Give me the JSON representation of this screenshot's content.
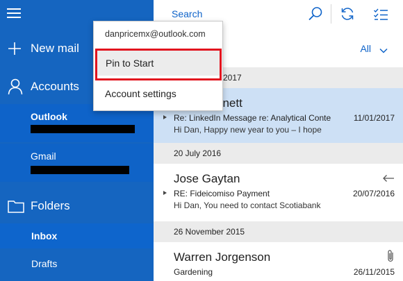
{
  "sidebar": {
    "new_mail": "New mail",
    "accounts": "Accounts",
    "account_list": [
      {
        "name": "Outlook"
      },
      {
        "name": "Gmail"
      }
    ],
    "folders": "Folders",
    "folder_list": [
      {
        "name": "Inbox",
        "selected": true
      },
      {
        "name": "Drafts",
        "selected": false
      }
    ]
  },
  "toolbar": {
    "search_placeholder": "Search",
    "filter_label": "All"
  },
  "popup": {
    "email": "danpricemx@outlook.com",
    "pin_to_start": "Pin to Start",
    "account_settings": "Account settings"
  },
  "groups": [
    {
      "date_header": "2017",
      "messages": [
        {
          "sender": "nnett",
          "subject": "Re: LinkedIn Message re: Analytical Conte",
          "date": "11/01/2017",
          "preview": "Hi Dan,     Happy new year to you – I hope",
          "selected": true
        }
      ]
    },
    {
      "date_header": "20 July 2016",
      "messages": [
        {
          "sender": "Jose Gaytan",
          "subject": "RE: Fideicomiso Payment",
          "date": "20/07/2016",
          "preview": "Hi Dan,     You need to contact Scotiabank",
          "icon": "reply-arrow-icon"
        }
      ]
    },
    {
      "date_header": "26 November 2015",
      "messages": [
        {
          "sender": "Warren Jorgenson",
          "subject": "Gardening",
          "date": "26/11/2015",
          "preview": "",
          "icon": "paperclip-icon"
        }
      ]
    }
  ],
  "colors": {
    "sidebar": "#1565c0",
    "accent": "#0e63c9",
    "selected_message": "#cde0f5",
    "highlight_box": "#e2131e"
  }
}
